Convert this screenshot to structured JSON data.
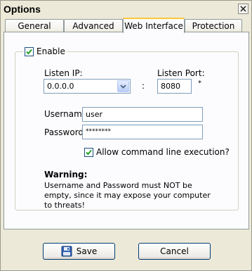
{
  "window": {
    "title": "Options",
    "close_icon": "close-icon"
  },
  "tabs": [
    {
      "label": "General",
      "active": false
    },
    {
      "label": "Advanced",
      "active": false
    },
    {
      "label": "Web Interface",
      "active": true
    },
    {
      "label": "Protection",
      "active": false
    }
  ],
  "web_interface": {
    "enable_label": "Enable",
    "enable_checked": true,
    "listen_ip_label": "Listen IP:",
    "listen_ip_value": "0.0.0.0",
    "colon": ":",
    "listen_port_label": "Listen Port:",
    "listen_port_value": "8080",
    "asterisk": "*",
    "username_label": "Username:",
    "username_value": "user",
    "password_label": "Password:",
    "password_value": "********",
    "allow_cmd_label": "Allow command line execution?",
    "allow_cmd_checked": true,
    "warning_title": "Warning:",
    "warning_text": "Username and Password must NOT be empty, since it may expose your computer to threats!"
  },
  "buttons": {
    "save_label": "Save",
    "save_icon": "floppy-disk-icon",
    "cancel_label": "Cancel"
  },
  "colors": {
    "window_bg": "#ece9d8",
    "panel_bg": "#fcfcfe",
    "active_tab_accent": "#ffc83c",
    "input_border": "#7f9db9",
    "check_color": "#21a121"
  }
}
